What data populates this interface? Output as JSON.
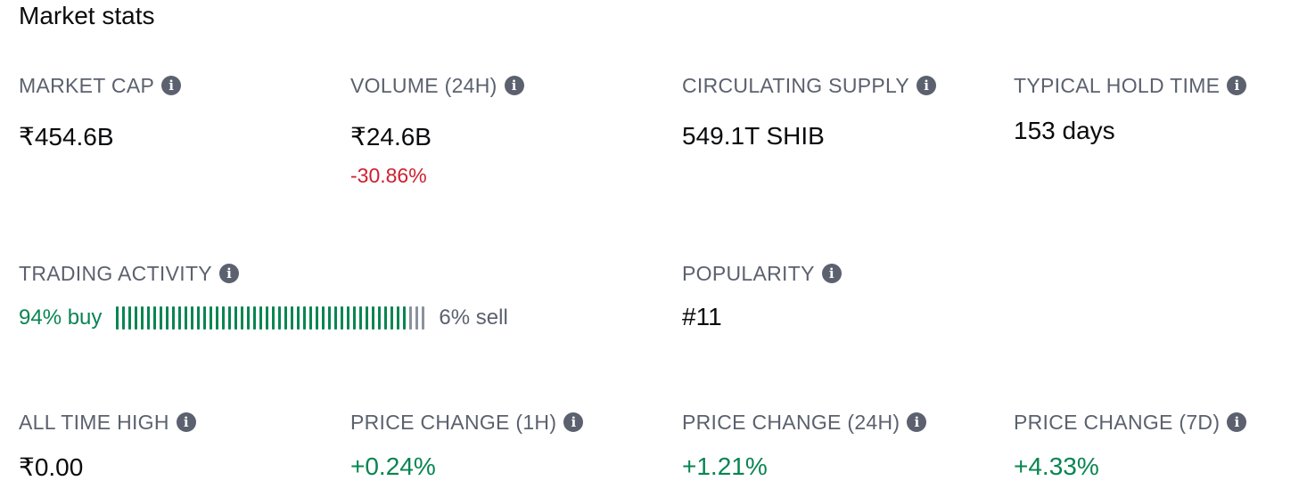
{
  "section_title": "Market stats",
  "stats": {
    "market_cap": {
      "label": "MARKET CAP",
      "value": "₹454.6B"
    },
    "volume": {
      "label": "VOLUME (24H)",
      "value": "₹24.6B",
      "change": "-30.86%"
    },
    "circulating_supply": {
      "label": "CIRCULATING SUPPLY",
      "value": "549.1T SHIB"
    },
    "typical_hold_time": {
      "label": "TYPICAL HOLD TIME",
      "value": "153 days"
    },
    "trading_activity": {
      "label": "TRADING ACTIVITY",
      "buy_text": "94% buy",
      "sell_text": "6% sell",
      "buy_fraction": 0.94
    },
    "popularity": {
      "label": "POPULARITY",
      "value": "#11"
    },
    "all_time_high": {
      "label": "ALL TIME HIGH",
      "value": "₹0.00"
    },
    "price_change_1h": {
      "label": "PRICE CHANGE (1H)",
      "value": "+0.24%"
    },
    "price_change_24h": {
      "label": "PRICE CHANGE (24H)",
      "value": "+1.21%"
    },
    "price_change_7d": {
      "label": "PRICE CHANGE (7D)",
      "value": "+4.33%"
    }
  },
  "icons": {
    "info": "info-icon"
  },
  "colors": {
    "label": "#5b616e",
    "positive": "#098551",
    "negative": "#cf202f",
    "sell_bar": "#8a919e"
  }
}
